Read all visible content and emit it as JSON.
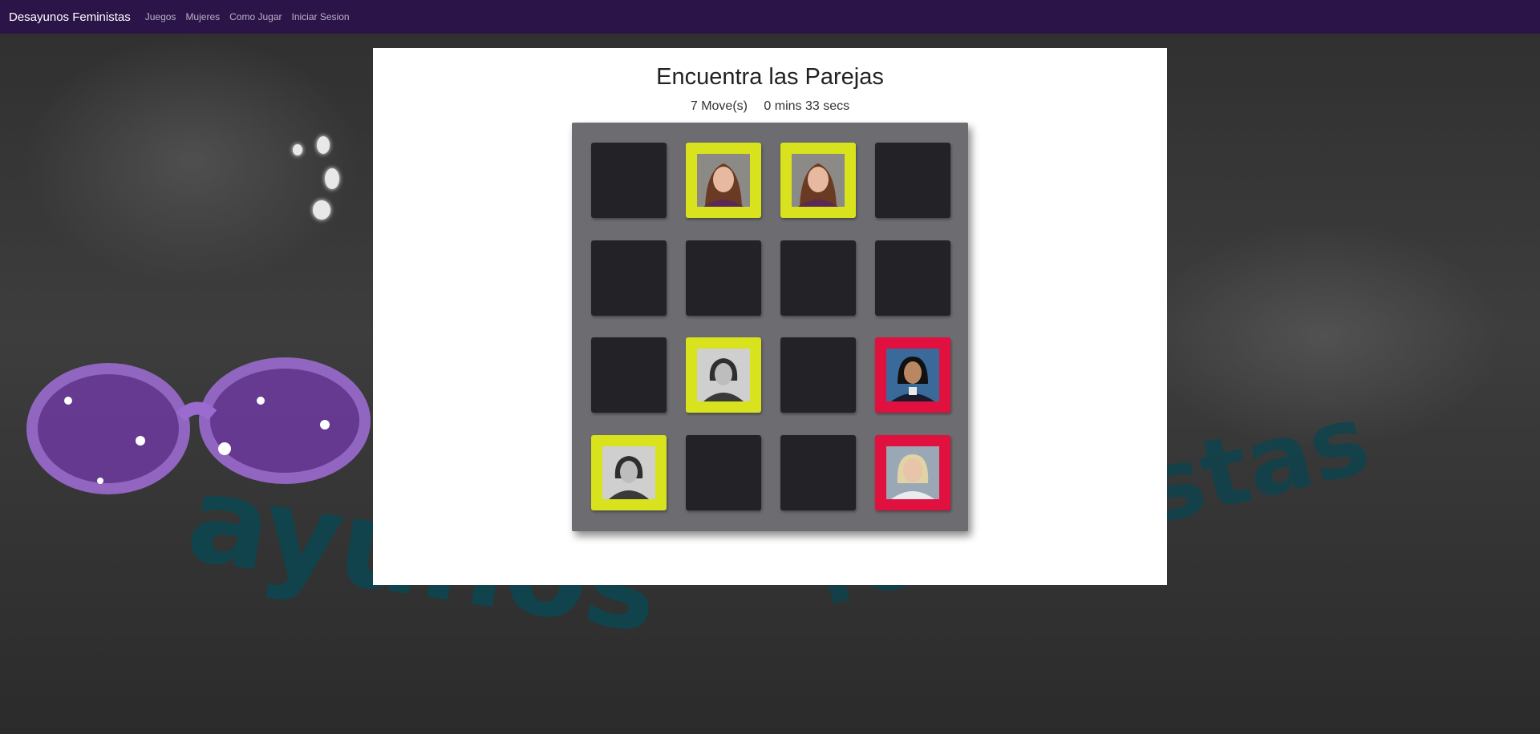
{
  "nav": {
    "brand": "Desayunos Feministas",
    "links": [
      "Juegos",
      "Mujeres",
      "Como Jugar",
      "Iniciar Sesion"
    ]
  },
  "game": {
    "title": "Encuentra las Parejas",
    "moves": "7 Move(s)",
    "timer": "0 mins 33 secs"
  },
  "background": {
    "text_line1": "ayunos",
    "text_line2": "feministas"
  },
  "colors": {
    "navbar": "#2b1548",
    "card_hidden": "#232226",
    "card_matched": "#d8e21d",
    "card_mismatch": "#e0103f",
    "board": "#6d6c70"
  },
  "cards": [
    {
      "state": "hidden"
    },
    {
      "state": "matched",
      "image": "woman-dark-hair-portrait"
    },
    {
      "state": "matched",
      "image": "woman-dark-hair-portrait"
    },
    {
      "state": "hidden"
    },
    {
      "state": "hidden"
    },
    {
      "state": "hidden"
    },
    {
      "state": "hidden"
    },
    {
      "state": "hidden"
    },
    {
      "state": "hidden"
    },
    {
      "state": "matched",
      "image": "historic-woman-bw-portrait"
    },
    {
      "state": "hidden"
    },
    {
      "state": "mismatch",
      "image": "woman-black-hair-portrait"
    },
    {
      "state": "matched",
      "image": "historic-woman-bw-portrait"
    },
    {
      "state": "hidden"
    },
    {
      "state": "hidden"
    },
    {
      "state": "mismatch",
      "image": "woman-blonde-portrait"
    }
  ]
}
